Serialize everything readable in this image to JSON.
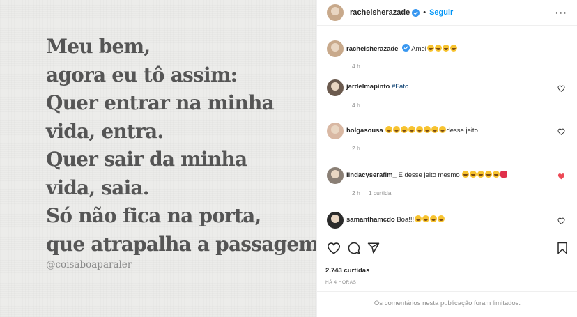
{
  "post": {
    "quote_lines": [
      "Meu bem,",
      "agora eu tô assim:",
      "Quer entrar na minha",
      "vida, entra.",
      "Quer sair da minha",
      "vida, saia.",
      "Só não fica na porta,",
      "que atrapalha a passagem."
    ],
    "image_handle": "@coisaboaparaler"
  },
  "header": {
    "username": "rachelsherazade",
    "separator": "•",
    "follow_label": "Seguir",
    "more_label": "···"
  },
  "comments": [
    {
      "username": "rachelsherazade",
      "text": "Amei",
      "emoji_count": 4,
      "emoji_red": false,
      "time": "4 h",
      "replies": "",
      "liked": false,
      "has_heart": false,
      "verified": true
    },
    {
      "username": "jardelmapinto",
      "text": "#Fato.",
      "emoji_count": 0,
      "emoji_red": false,
      "time": "4 h",
      "replies": "",
      "liked": false,
      "has_heart": true,
      "verified": false
    },
    {
      "username": "holgasousa",
      "text_prefix": "",
      "emoji_count": 8,
      "text_suffix": "desse jeito",
      "emoji_red": false,
      "time": "2 h",
      "replies": "",
      "liked": false,
      "has_heart": true,
      "verified": false
    },
    {
      "username": "lindacyserafim_",
      "text": "E desse jeito mesmo",
      "emoji_count": 5,
      "emoji_red": true,
      "time": "2 h",
      "replies": "1 curtida",
      "liked": true,
      "has_heart": true,
      "verified": false
    },
    {
      "username": "samanthamcdo",
      "text": "Boa!!!",
      "emoji_count": 4,
      "emoji_red": false,
      "time": "2 h",
      "replies": "",
      "liked": false,
      "has_heart": true,
      "verified": false
    }
  ],
  "likes_label": "2.743 curtidas",
  "time_label": "HÁ 4 HORAS",
  "comments_limited": "Os comentários nesta publicação foram limitados.",
  "icons": {
    "like": "heart-outline-icon",
    "comment": "comment-bubble-icon",
    "share": "paper-plane-icon",
    "save": "bookmark-icon"
  },
  "colors": {
    "accent": "#0095f6",
    "liked": "#ed4956",
    "muted": "#8e8e8e"
  }
}
